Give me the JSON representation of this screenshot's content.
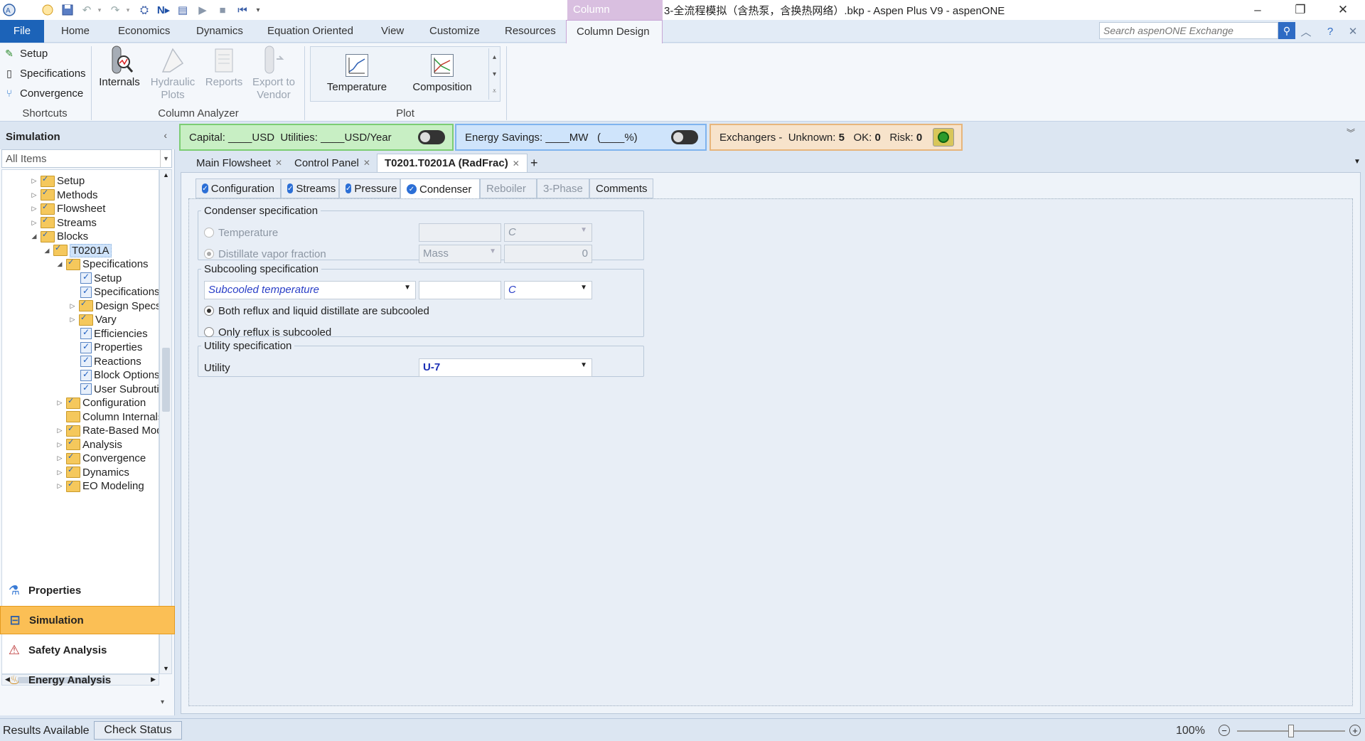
{
  "window": {
    "title": "3-全流程模拟（含热泵，含换热网络）.bkp - Aspen Plus V9 - aspenONE",
    "context_tab": "Column"
  },
  "ribbon_tabs": [
    "File",
    "Home",
    "Economics",
    "Dynamics",
    "Equation Oriented",
    "View",
    "Customize",
    "Resources",
    "Column Design"
  ],
  "search": {
    "placeholder": "Search aspenONE Exchange"
  },
  "shortcuts": {
    "items": [
      "Setup",
      "Specifications",
      "Convergence"
    ],
    "group_label": "Shortcuts"
  },
  "column_analyzer": {
    "buttons": [
      {
        "label": "Internals",
        "enabled": true
      },
      {
        "label": "Hydraulic Plots",
        "enabled": false
      },
      {
        "label": "Reports",
        "enabled": false
      },
      {
        "label": "Export to Vendor",
        "enabled": false
      }
    ],
    "group_label": "Column Analyzer"
  },
  "plot": {
    "buttons": [
      "Temperature",
      "Composition"
    ],
    "group_label": "Plot"
  },
  "navigator": {
    "title": "Simulation",
    "filter": "All Items",
    "tree": [
      {
        "label": "Setup",
        "depth": 0,
        "expander": "▷",
        "icon": "folder-check"
      },
      {
        "label": "Methods",
        "depth": 0,
        "expander": "▷",
        "icon": "folder-check"
      },
      {
        "label": "Flowsheet",
        "depth": 0,
        "expander": "▷",
        "icon": "folder-check"
      },
      {
        "label": "Streams",
        "depth": 0,
        "expander": "▷",
        "icon": "folder-check"
      },
      {
        "label": "Blocks",
        "depth": 0,
        "expander": "◢",
        "icon": "folder-check"
      },
      {
        "label": "T0201A",
        "depth": 1,
        "expander": "◢",
        "icon": "folder-check",
        "selected": true
      },
      {
        "label": "Specifications",
        "depth": 2,
        "expander": "◢",
        "icon": "folder-check"
      },
      {
        "label": "Setup",
        "depth": 3,
        "expander": "",
        "icon": "form"
      },
      {
        "label": "Specifications",
        "depth": 3,
        "expander": "",
        "icon": "form"
      },
      {
        "label": "Design Specs",
        "depth": 3,
        "expander": "▷",
        "icon": "folder-check"
      },
      {
        "label": "Vary",
        "depth": 3,
        "expander": "▷",
        "icon": "folder-check"
      },
      {
        "label": "Efficiencies",
        "depth": 3,
        "expander": "",
        "icon": "form"
      },
      {
        "label": "Properties",
        "depth": 3,
        "expander": "",
        "icon": "form"
      },
      {
        "label": "Reactions",
        "depth": 3,
        "expander": "",
        "icon": "form"
      },
      {
        "label": "Block Options",
        "depth": 3,
        "expander": "",
        "icon": "form"
      },
      {
        "label": "User Subroutines",
        "depth": 3,
        "expander": "",
        "icon": "form"
      },
      {
        "label": "Configuration",
        "depth": 2,
        "expander": "▷",
        "icon": "folder-check"
      },
      {
        "label": "Column Internals",
        "depth": 2,
        "expander": "",
        "icon": "folder"
      },
      {
        "label": "Rate-Based Modeling",
        "depth": 2,
        "expander": "▷",
        "icon": "folder-check"
      },
      {
        "label": "Analysis",
        "depth": 2,
        "expander": "▷",
        "icon": "folder-check"
      },
      {
        "label": "Convergence",
        "depth": 2,
        "expander": "▷",
        "icon": "folder-check"
      },
      {
        "label": "Dynamics",
        "depth": 2,
        "expander": "▷",
        "icon": "folder-check"
      },
      {
        "label": "EO Modeling",
        "depth": 2,
        "expander": "▷",
        "icon": "folder-check"
      }
    ],
    "sections": [
      "Properties",
      "Simulation",
      "Safety Analysis",
      "Energy Analysis"
    ]
  },
  "econ": {
    "capital_label": "Capital:",
    "capital_unit": "____USD",
    "utilities_label": "Utilities:",
    "utilities_unit": "____USD/Year"
  },
  "energy": {
    "label": "Energy Savings:",
    "value": "____MW",
    "percent": "(____%)"
  },
  "exchangers": {
    "label": "Exchangers -",
    "unknown_label": "Unknown:",
    "unknown": "5",
    "ok_label": "OK:",
    "ok": "0",
    "risk_label": "Risk:",
    "risk": "0"
  },
  "doc_tabs": [
    {
      "label": "Main Flowsheet",
      "active": false
    },
    {
      "label": "Control Panel",
      "active": false
    },
    {
      "label": "T0201.T0201A (RadFrac)",
      "active": true
    }
  ],
  "form_tabs": [
    {
      "label": "Configuration",
      "check": true,
      "active": false,
      "enabled": true
    },
    {
      "label": "Streams",
      "check": true,
      "active": false,
      "enabled": true
    },
    {
      "label": "Pressure",
      "check": true,
      "active": false,
      "enabled": true
    },
    {
      "label": "Condenser",
      "check": true,
      "active": true,
      "enabled": true
    },
    {
      "label": "Reboiler",
      "check": false,
      "active": false,
      "enabled": false
    },
    {
      "label": "3-Phase",
      "check": false,
      "active": false,
      "enabled": false
    },
    {
      "label": "Comments",
      "check": false,
      "active": false,
      "enabled": true
    }
  ],
  "condenser_spec": {
    "legend": "Condenser specification",
    "temperature_label": "Temperature",
    "temperature_value": "",
    "temperature_unit": "C",
    "vapor_fraction_label": "Distillate vapor fraction",
    "vapor_fraction_basis": "Mass",
    "vapor_fraction_value": "0"
  },
  "subcooling_spec": {
    "legend": "Subcooling specification",
    "type": "Subcooled temperature",
    "value": "",
    "unit": "C",
    "option_both": "Both reflux and liquid distillate are subcooled",
    "option_reflux": "Only reflux is subcooled",
    "selected": "both"
  },
  "utility_spec": {
    "legend": "Utility specification",
    "label": "Utility",
    "value": "U-7"
  },
  "status": {
    "text": "Results Available",
    "check_button": "Check Status",
    "zoom": "100%"
  }
}
